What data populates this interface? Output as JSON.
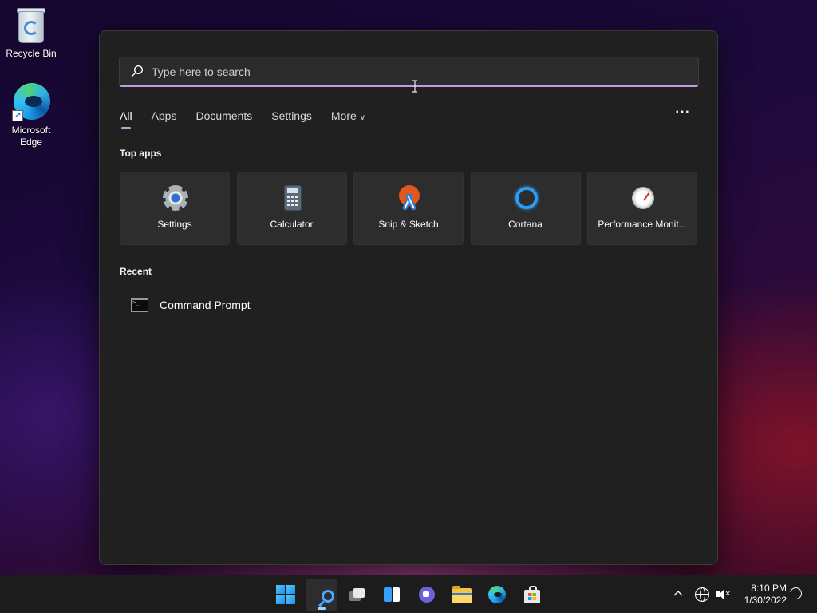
{
  "desktop": {
    "icons": [
      {
        "label": "Recycle Bin",
        "icon": "recycle-bin-icon"
      },
      {
        "label": "Microsoft Edge",
        "icon": "edge-icon"
      }
    ]
  },
  "search": {
    "placeholder": "Type here to search",
    "value": ""
  },
  "tabs": [
    {
      "label": "All",
      "active": true
    },
    {
      "label": "Apps"
    },
    {
      "label": "Documents"
    },
    {
      "label": "Settings"
    },
    {
      "label": "More"
    }
  ],
  "more_options_label": "···",
  "top_apps": {
    "title": "Top apps",
    "items": [
      {
        "label": "Settings",
        "icon": "settings-gear-icon"
      },
      {
        "label": "Calculator",
        "icon": "calculator-icon"
      },
      {
        "label": "Snip & Sketch",
        "icon": "snip-sketch-icon"
      },
      {
        "label": "Cortana",
        "icon": "cortana-icon"
      },
      {
        "label": "Performance Monit...",
        "icon": "performance-monitor-icon"
      }
    ]
  },
  "recent": {
    "title": "Recent",
    "items": [
      {
        "label": "Command Prompt",
        "icon": "command-prompt-icon"
      }
    ]
  },
  "taskbar": {
    "apps": [
      {
        "name": "Start",
        "icon": "windows-start-icon"
      },
      {
        "name": "Search",
        "icon": "search-icon",
        "active": true
      },
      {
        "name": "Task View",
        "icon": "task-view-icon"
      },
      {
        "name": "Widgets",
        "icon": "widgets-icon"
      },
      {
        "name": "Chat",
        "icon": "teams-chat-icon"
      },
      {
        "name": "File Explorer",
        "icon": "folder-icon"
      },
      {
        "name": "Microsoft Edge",
        "icon": "edge-icon"
      },
      {
        "name": "Microsoft Store",
        "icon": "store-icon"
      }
    ],
    "tray": {
      "chevron": "^",
      "time": "8:10 PM",
      "date": "1/30/2022"
    }
  },
  "colors": {
    "accent": "#c39be0",
    "panel": "#202020",
    "tile": "#2d2d2d",
    "taskbar": "#1c1c1c"
  }
}
